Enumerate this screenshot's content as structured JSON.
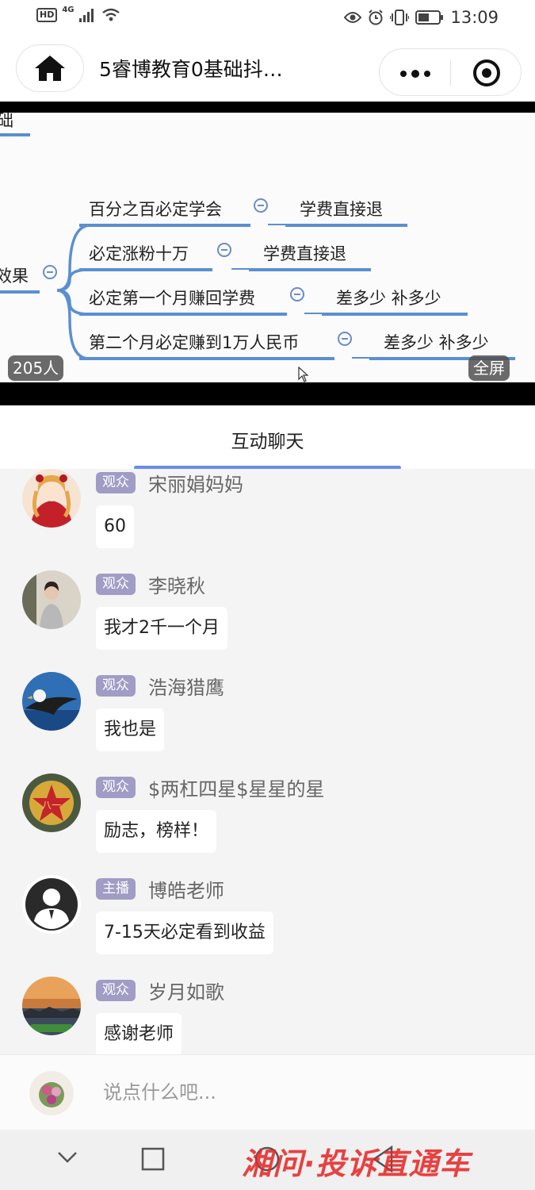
{
  "status_bar": {
    "hd": "HD",
    "network": "4G",
    "time": "13:09",
    "icons": [
      "signal-icon",
      "wifi-icon",
      "eye-icon",
      "alarm-icon",
      "vibrate-icon",
      "battery-icon"
    ]
  },
  "title_bar": {
    "title": "5睿博教育0基础抖…",
    "icons": [
      "home-icon",
      "more-icon",
      "target-icon"
    ]
  },
  "video": {
    "slide": {
      "top_fragment": "础",
      "left_fragment": "效果",
      "branches": [
        {
          "item": "百分之百必定学会",
          "result": "学费直接退"
        },
        {
          "item": "必定涨粉十万",
          "result": "学费直接退"
        },
        {
          "item": "必定第一个月赚回学费",
          "result": "差多少 补多少"
        },
        {
          "item": "第二个月必定赚到1万人民币",
          "result": "差多少 补多少"
        }
      ]
    },
    "viewer_count": "205人",
    "fullscreen_label": "全屏"
  },
  "tabs": {
    "active": "互动聊天"
  },
  "messages": [
    {
      "role": "观众",
      "name": "宋丽娟妈妈",
      "text": "60",
      "avatar": "avatar-red-doll"
    },
    {
      "role": "观众",
      "name": "李晓秋",
      "text": "我才2千一个月",
      "avatar": "avatar-woman"
    },
    {
      "role": "观众",
      "name": "浩海猎鹰",
      "text": "我也是",
      "avatar": "avatar-eagle"
    },
    {
      "role": "观众",
      "name": "$两杠四星$星星的星",
      "text": "励志，榜样！",
      "avatar": "avatar-emblem"
    },
    {
      "role": "主播",
      "name": "博皓老师",
      "text": "7-15天必定看到收益",
      "avatar": "avatar-default-user"
    },
    {
      "role": "观众",
      "name": "岁月如歌",
      "text": "感谢老师",
      "avatar": "avatar-sunset"
    }
  ],
  "input": {
    "placeholder": "说点什么吧..."
  },
  "watermark": "湘问·投诉直通车",
  "colors": {
    "tab_accent": "#6a8de8",
    "role_badge": "#a09cc6",
    "mindmap_line": "#5b8fd0",
    "watermark": "#e62828"
  }
}
